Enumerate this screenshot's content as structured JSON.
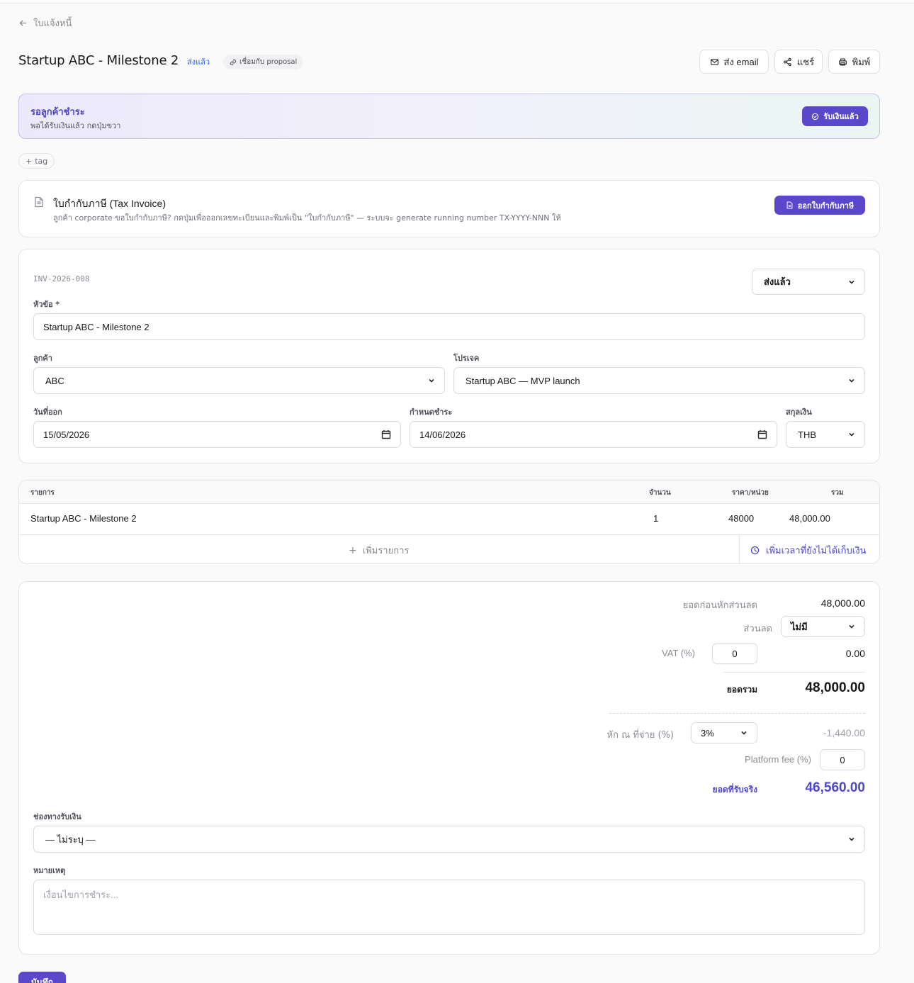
{
  "breadcrumb": {
    "back_label": "ใบแจ้งหนี้"
  },
  "header": {
    "title": "Startup ABC - Milestone 2",
    "status_badge": "ส่งแล้ว",
    "linked_badge": "เชื่อมกับ proposal",
    "actions": {
      "email": "ส่ง email",
      "share": "แชร์",
      "print": "พิมพ์"
    }
  },
  "banner": {
    "heading": "รอลูกค้าชำระ",
    "subtext": "พอได้รับเงินแล้ว กดปุ่มขวา",
    "button": "รับเงินแล้ว"
  },
  "tag_button": "tag",
  "tax_invoice": {
    "title": "ใบกำกับภาษี (Tax Invoice)",
    "description": "ลูกค้า corporate ขอใบกำกับภาษี? กดปุ่มเพื่อออกเลขทะเบียนและพิมพ์เป็น \"ใบกำกับภาษี\" — ระบบจะ generate running number TX-YYYY-NNN ให้",
    "button": "ออกใบกำกับภาษี"
  },
  "form": {
    "invoice_number": "INV-2026-008",
    "status_select": "ส่งแล้ว",
    "subject_label": "หัวข้อ *",
    "subject_value": "Startup ABC - Milestone 2",
    "customer_label": "ลูกค้า",
    "customer_value": "ABC",
    "project_label": "โปรเจค",
    "project_value": "Startup ABC — MVP launch",
    "issue_date_label": "วันที่ออก",
    "issue_date_value": "15/05/2026",
    "due_date_label": "กำหนดชำระ",
    "due_date_value": "14/06/2026",
    "currency_label": "สกุลเงิน",
    "currency_value": "THB"
  },
  "items": {
    "headers": {
      "item": "รายการ",
      "qty": "จำนวน",
      "price": "ราคา/หน่วย",
      "total": "รวม"
    },
    "rows": [
      {
        "name": "Startup ABC - Milestone 2",
        "qty": "1",
        "price": "48000",
        "total": "48,000.00"
      }
    ],
    "add_item": "เพิ่มรายการ",
    "add_time": "เพิ่มเวลาที่ยังไม่ได้เก็บเงิน"
  },
  "summary": {
    "subtotal_label": "ยอดก่อนหักส่วนลด",
    "subtotal_value": "48,000.00",
    "discount_label": "ส่วนลด",
    "discount_value": "ไม่มี",
    "vat_label": "VAT (%)",
    "vat_input": "0",
    "vat_amount": "0.00",
    "total_label": "ยอดรวม",
    "total_value": "48,000.00",
    "wht_label": "หัก ณ ที่จ่าย (%)",
    "wht_value": "3%",
    "wht_amount": "-1,440.00",
    "platform_fee_label": "Platform fee (%)",
    "platform_fee_value": "0",
    "net_label": "ยอดที่รับจริง",
    "net_value": "46,560.00"
  },
  "payment": {
    "channel_label": "ช่องทางรับเงิน",
    "channel_value": "— ไม่ระบุ —",
    "note_label": "หมายเหตุ",
    "note_placeholder": "เงื่อนไขการชำระ..."
  },
  "save_button": "บันทึก",
  "colors": {
    "accent": "#5b47c9",
    "status_blue": "#2563eb"
  }
}
